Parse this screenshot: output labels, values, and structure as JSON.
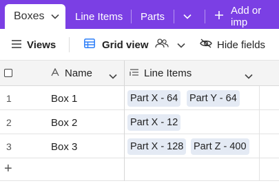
{
  "tabs": {
    "active": "Boxes",
    "items": [
      "Line Items",
      "Parts"
    ],
    "add_label": "Add or imp"
  },
  "toolbar": {
    "views_label": "Views",
    "grid_view_label": "Grid view",
    "hide_fields_label": "Hide fields"
  },
  "grid": {
    "columns": [
      {
        "label": "Name"
      },
      {
        "label": "Line Items"
      }
    ],
    "rows": [
      {
        "num": "1",
        "name": "Box 1",
        "items": [
          "Part X - 64",
          "Part Y - 64"
        ]
      },
      {
        "num": "2",
        "name": "Box 2",
        "items": [
          "Part X - 12"
        ]
      },
      {
        "num": "3",
        "name": "Box 3",
        "items": [
          "Part X - 128",
          "Part Z - 400"
        ]
      }
    ],
    "add_row_symbol": "+"
  },
  "colors": {
    "brand": "#7b3fe4",
    "chip": "#e4eaf4",
    "grid_view_icon": "#2d7ff9"
  }
}
